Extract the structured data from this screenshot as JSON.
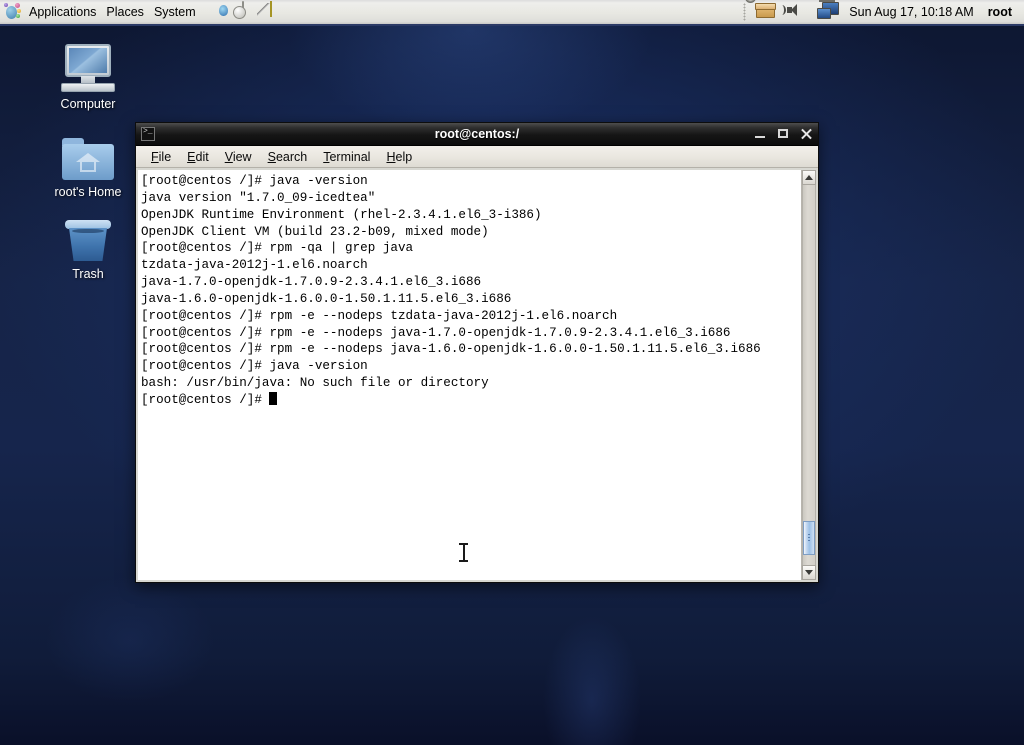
{
  "panel": {
    "applications_label": "Applications",
    "places_label": "Places",
    "system_label": "System",
    "launchers": [
      {
        "name": "firefox-icon",
        "title": "Firefox Web Browser"
      },
      {
        "name": "evolution-icon",
        "title": "Evolution Mail"
      },
      {
        "name": "notes-icon",
        "title": "Notes"
      }
    ],
    "tray": [
      {
        "name": "package-updater-icon"
      },
      {
        "name": "volume-icon"
      },
      {
        "name": "network-icon"
      }
    ],
    "clock": "Sun Aug 17, 10:18 AM",
    "user": "root"
  },
  "desktop": {
    "icons": [
      {
        "label": "Computer",
        "icon": "computer-icon"
      },
      {
        "label": "root's Home",
        "icon": "home-folder-icon"
      },
      {
        "label": "Trash",
        "icon": "trash-icon"
      }
    ]
  },
  "terminal": {
    "title": "root@centos:/",
    "window_buttons": {
      "minimize": "Minimize",
      "maximize": "Maximize",
      "close": "Close"
    },
    "menu": [
      {
        "label": "File",
        "mnemonic": "F"
      },
      {
        "label": "Edit",
        "mnemonic": "E"
      },
      {
        "label": "View",
        "mnemonic": "V"
      },
      {
        "label": "Search",
        "mnemonic": "S"
      },
      {
        "label": "Terminal",
        "mnemonic": "T"
      },
      {
        "label": "Help",
        "mnemonic": "H"
      }
    ],
    "prompt": "[root@centos /]#",
    "lines": [
      "[root@centos /]# java -version",
      "java version \"1.7.0_09-icedtea\"",
      "OpenJDK Runtime Environment (rhel-2.3.4.1.el6_3-i386)",
      "OpenJDK Client VM (build 23.2-b09, mixed mode)",
      "[root@centos /]# rpm -qa | grep java",
      "tzdata-java-2012j-1.el6.noarch",
      "java-1.7.0-openjdk-1.7.0.9-2.3.4.1.el6_3.i686",
      "java-1.6.0-openjdk-1.6.0.0-1.50.1.11.5.el6_3.i686",
      "[root@centos /]# rpm -e --nodeps tzdata-java-2012j-1.el6.noarch",
      "[root@centos /]# rpm -e --nodeps java-1.7.0-openjdk-1.7.0.9-2.3.4.1.el6_3.i686",
      "[root@centos /]# rpm -e --nodeps java-1.6.0-openjdk-1.6.0.0-1.50.1.11.5.el6_3.i686",
      "[root@centos /]# java -version",
      "bash: /usr/bin/java: No such file or directory"
    ],
    "last_line": "[root@centos /]# ",
    "scrollbar": {
      "up_label": "Scroll up",
      "down_label": "Scroll down"
    }
  },
  "colors": {
    "desktop_bg": "#16254c",
    "panel_bg": "#e8e8e2",
    "titlebar_bg": "#151515",
    "terminal_bg": "#ffffff",
    "terminal_fg": "#000000",
    "scrollbar_thumb": "#9cc0e6"
  }
}
